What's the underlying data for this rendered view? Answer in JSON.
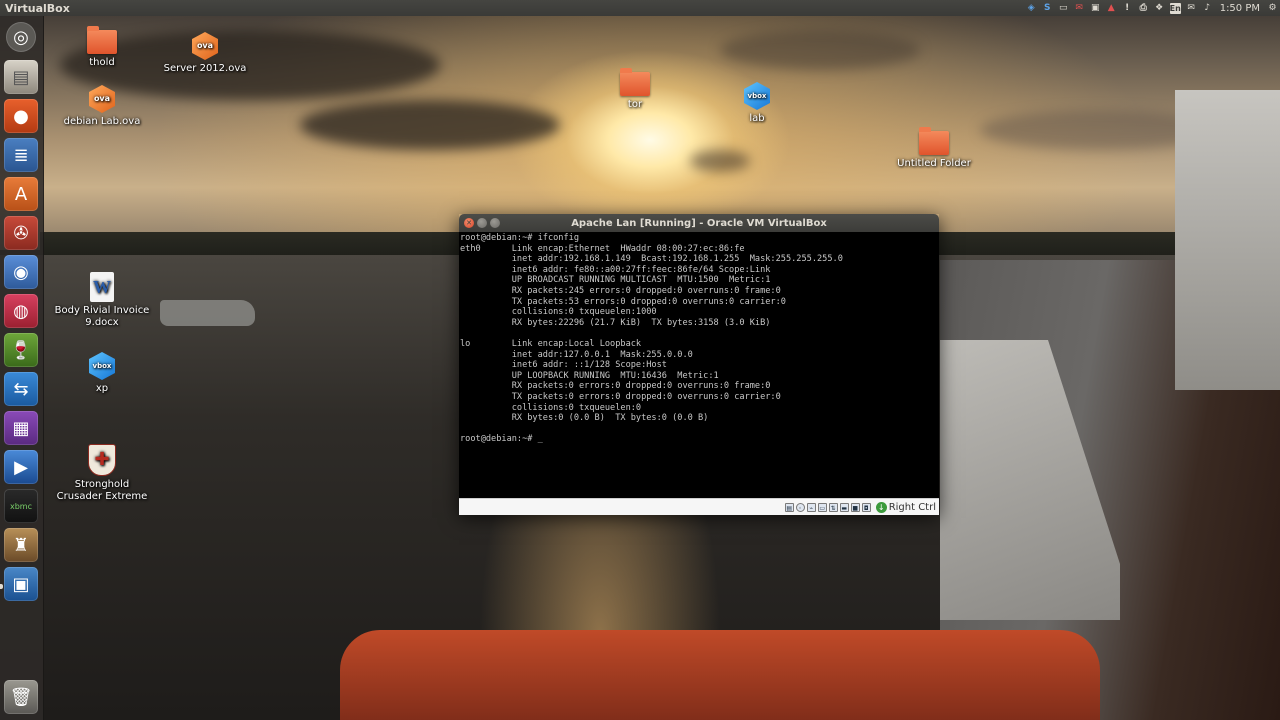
{
  "top_panel": {
    "app_title": "VirtualBox",
    "clock": "1:50 PM",
    "keyboard_layout": "En",
    "indicator_icons": [
      "virtualbox-icon",
      "skype-icon",
      "video-icon",
      "mail-alert-icon",
      "error-icon",
      "warning-icon",
      "printer-icon",
      "dropbox-icon",
      "keyboard-icon",
      "mail-icon",
      "volume-icon",
      "gear-icon"
    ]
  },
  "launcher": {
    "items": [
      {
        "name": "dash-home",
        "icon": "ubuntu-logo-icon"
      },
      {
        "name": "files",
        "icon": "file-cabinet-icon"
      },
      {
        "name": "firefox",
        "icon": "firefox-icon"
      },
      {
        "name": "libreoffice-writer",
        "icon": "writer-icon"
      },
      {
        "name": "software-center",
        "icon": "shopping-bag-icon"
      },
      {
        "name": "system-settings",
        "icon": "settings-icon"
      },
      {
        "name": "chromium",
        "icon": "chromium-icon"
      },
      {
        "name": "disc-burner",
        "icon": "disc-icon"
      },
      {
        "name": "playonlinux",
        "icon": "wine-glass-icon"
      },
      {
        "name": "teamviewer",
        "icon": "teamviewer-icon"
      },
      {
        "name": "video-editor",
        "icon": "film-icon"
      },
      {
        "name": "media-player",
        "icon": "play-icon"
      },
      {
        "name": "xbmc",
        "icon": "xbmc-icon"
      },
      {
        "name": "game",
        "icon": "game-icon"
      },
      {
        "name": "virtualbox",
        "icon": "virtualbox-icon"
      },
      {
        "name": "trash",
        "icon": "trash-icon"
      }
    ],
    "xbmc_label": "xbmc"
  },
  "desktop": {
    "icons": {
      "thold": "thold",
      "server_ova": "Server 2012.ova",
      "debian_ova": "debian Lab.ova",
      "tor": "tor",
      "lab": "lab",
      "untitled_folder": "Untitled Folder",
      "invoice": "Body Rivial Invoice 9.docx",
      "xp": "xp",
      "stronghold": "Stronghold Crusader Extreme"
    },
    "ova_badge": "ova",
    "vbox_badge": "vbox"
  },
  "vbox_window": {
    "title": "Apache Lan [Running] - Oracle VM VirtualBox",
    "host_key": "Right Ctrl",
    "terminal_lines": [
      "root@debian:~# ifconfig",
      "eth0      Link encap:Ethernet  HWaddr 08:00:27:ec:86:fe",
      "          inet addr:192.168.1.149  Bcast:192.168.1.255  Mask:255.255.255.0",
      "          inet6 addr: fe80::a00:27ff:feec:86fe/64 Scope:Link",
      "          UP BROADCAST RUNNING MULTICAST  MTU:1500  Metric:1",
      "          RX packets:245 errors:0 dropped:0 overruns:0 frame:0",
      "          TX packets:53 errors:0 dropped:0 overruns:0 carrier:0",
      "          collisions:0 txqueuelen:1000",
      "          RX bytes:22296 (21.7 KiB)  TX bytes:3158 (3.0 KiB)",
      "",
      "lo        Link encap:Local Loopback",
      "          inet addr:127.0.0.1  Mask:255.0.0.0",
      "          inet6 addr: ::1/128 Scope:Host",
      "          UP LOOPBACK RUNNING  MTU:16436  Metric:1",
      "          RX packets:0 errors:0 dropped:0 overruns:0 frame:0",
      "          TX packets:0 errors:0 dropped:0 overruns:0 carrier:0",
      "          collisions:0 txqueuelen:0",
      "          RX bytes:0 (0.0 B)  TX bytes:0 (0.0 B)",
      "",
      "root@debian:~# _"
    ]
  }
}
